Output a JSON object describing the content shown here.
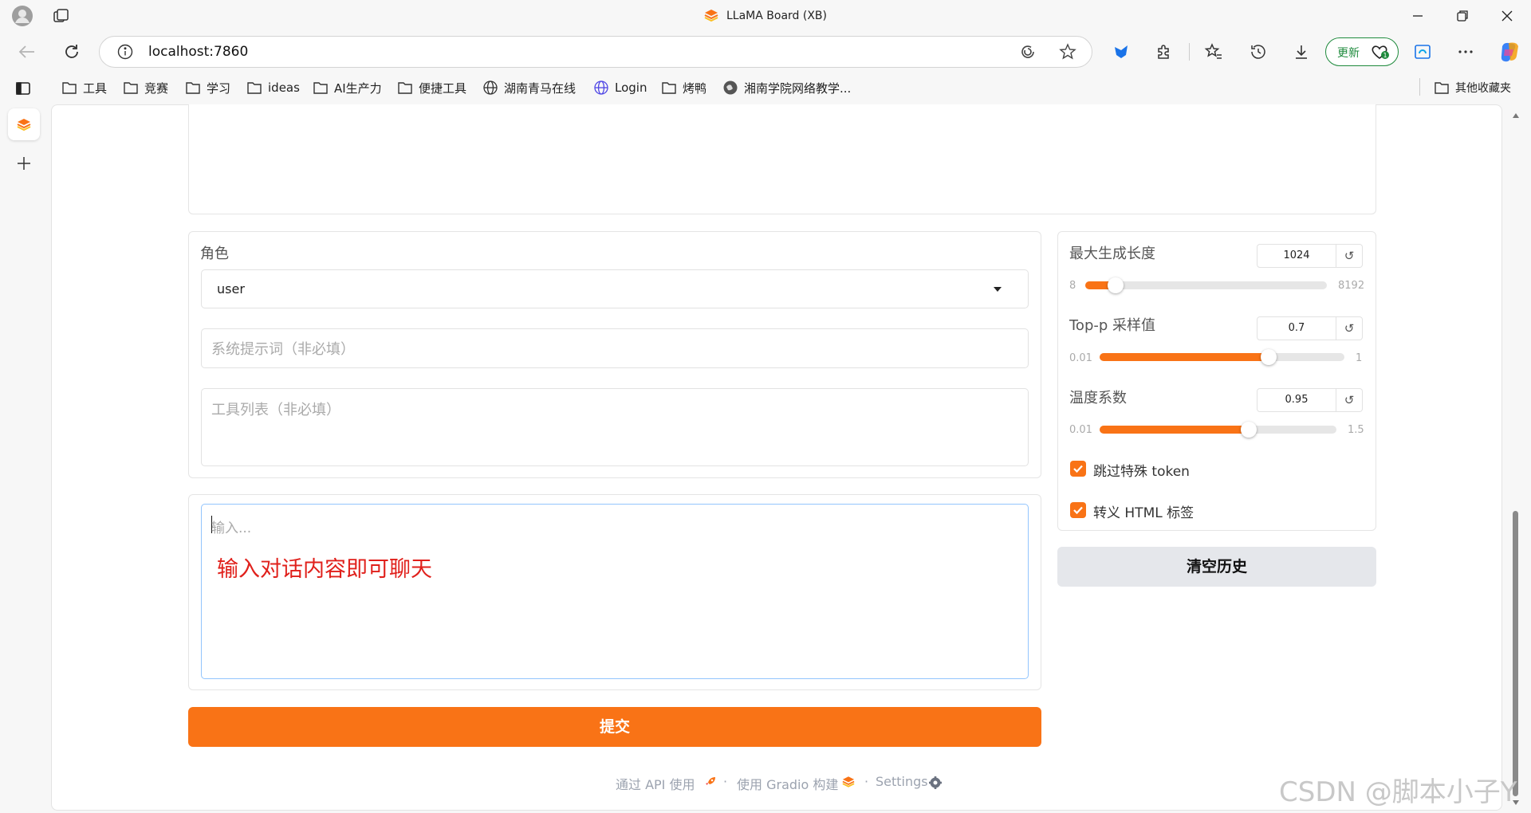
{
  "window": {
    "title": "LLaMA Board (XB)"
  },
  "browser": {
    "url": "localhost:7860",
    "update_label": "更新"
  },
  "bookmarks": [
    {
      "label": "工具",
      "icon": "folder-icon"
    },
    {
      "label": "竞赛",
      "icon": "folder-icon"
    },
    {
      "label": "学习",
      "icon": "folder-icon"
    },
    {
      "label": "ideas",
      "icon": "folder-icon"
    },
    {
      "label": "AI生产力",
      "icon": "folder-icon"
    },
    {
      "label": "便捷工具",
      "icon": "folder-icon"
    },
    {
      "label": "湖南青马在线",
      "icon": "globe-icon"
    },
    {
      "label": "Login",
      "icon": "globe-icon"
    },
    {
      "label": "烤鸭",
      "icon": "folder-icon"
    },
    {
      "label": "湘南学院网络教学...",
      "icon": "globe-icon"
    }
  ],
  "other_bookmarks": "其他收藏夹",
  "chat": {
    "role_label": "角色",
    "role_value": "user",
    "system_placeholder": "系统提示词（非必填）",
    "tools_placeholder": "工具列表（非必填）",
    "input_placeholder": "输入...",
    "annotation": "输入对话内容即可聊天",
    "submit_label": "提交",
    "clear_label": "清空历史"
  },
  "params": {
    "max_new_tokens": {
      "label": "最大生成长度",
      "value": "1024",
      "min": "8",
      "max": "8192",
      "fraction": 0.125
    },
    "top_p": {
      "label": "Top-p 采样值",
      "value": "0.7",
      "min": "0.01",
      "max": "1",
      "fraction": 0.69
    },
    "temperature": {
      "label": "温度系数",
      "value": "0.95",
      "min": "0.01",
      "max": "1.5",
      "fraction": 0.63
    },
    "skip_special_tokens": {
      "label": "跳过特殊 token",
      "checked": true
    },
    "escape_html": {
      "label": "转义 HTML 标签",
      "checked": true
    }
  },
  "footer": {
    "api": "通过 API 使用",
    "gradio": "使用 Gradio 构建",
    "settings": "Settings",
    "dot": "·"
  },
  "watermark": "CSDN @脚本小子Y",
  "colors": {
    "accent": "#f97316",
    "update_green": "#1e8a3c",
    "annotation_red": "#e0201b"
  }
}
